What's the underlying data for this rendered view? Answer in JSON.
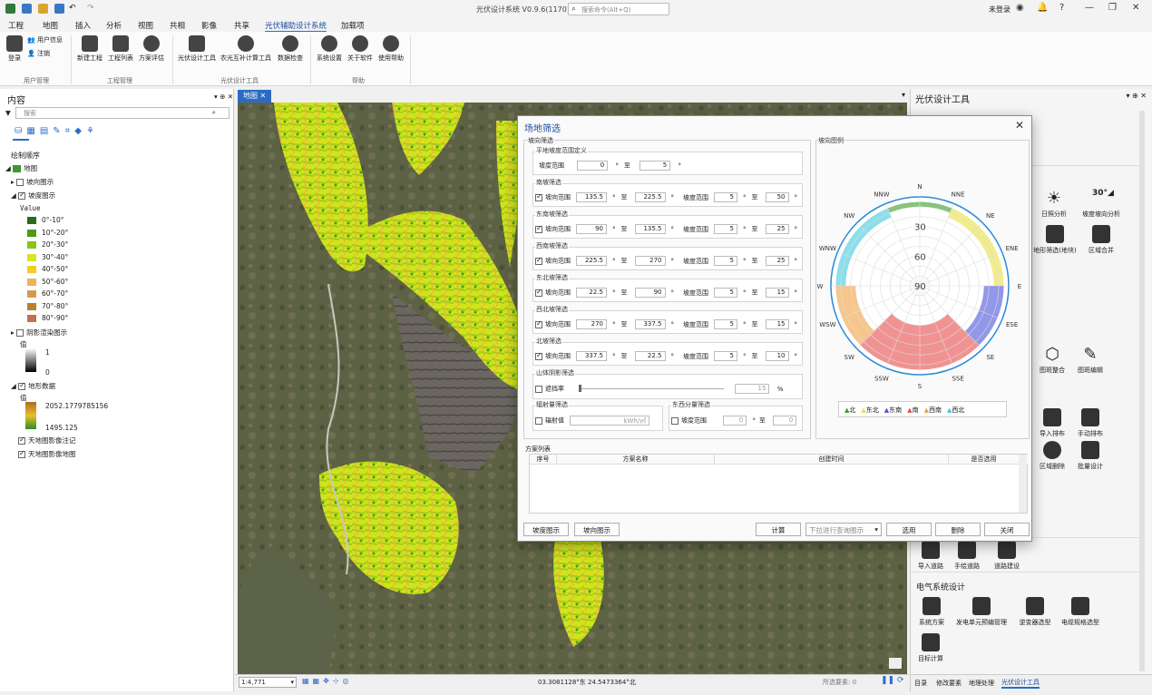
{
  "app": {
    "title": "光伏设计系统 V0.9.6(1170)",
    "search_placeholder": "搜索命令(Alt+Q)",
    "login": "未登录"
  },
  "ribbon": {
    "tabs": [
      "工程",
      "地图",
      "插入",
      "分析",
      "视图",
      "共相",
      "影像",
      "共享",
      "光伏辅助设计系统",
      "加载项"
    ],
    "active_tab": "光伏辅助设计系统",
    "user_group": {
      "label": "用户管理",
      "items": [
        "登录",
        "用户信息",
        "注销"
      ]
    },
    "project_group": {
      "label": "工程管理",
      "items": [
        "新建工程",
        "工程列表",
        "方案评估"
      ]
    },
    "pv_group": {
      "label": "光伏设计工具",
      "items": [
        "光伏设计工具",
        "农光互补计算工具",
        "数据检查"
      ]
    },
    "help_group": {
      "label": "帮助",
      "items": [
        "系统设置",
        "关于软件",
        "使用帮助"
      ]
    }
  },
  "contents": {
    "title": "内容",
    "search_placeholder": "搜索",
    "drawing_order": "绘制顺序",
    "map": "地图",
    "layers": [
      {
        "name": "坡向图示",
        "checked": false
      },
      {
        "name": "坡度图示",
        "checked": true
      }
    ],
    "value_label": "Value",
    "slope_legend": [
      {
        "label": "0°-10°",
        "color": "#2d6b18"
      },
      {
        "label": "10°-20°",
        "color": "#4e9a1a"
      },
      {
        "label": "20°-30°",
        "color": "#8dc21c"
      },
      {
        "label": "30°-40°",
        "color": "#d8e623"
      },
      {
        "label": "40°-50°",
        "color": "#f2cf1e"
      },
      {
        "label": "50°-60°",
        "color": "#eab45e"
      },
      {
        "label": "60°-70°",
        "color": "#d69a4f"
      },
      {
        "label": "70°-80°",
        "color": "#b7822d"
      },
      {
        "label": "80°-90°",
        "color": "#c46f56"
      }
    ],
    "hillshade": {
      "name": "阴影渲染图示",
      "checked": false,
      "value_label": "值",
      "max": "1",
      "min": "0"
    },
    "terrain": {
      "name": "地形数据",
      "checked": true,
      "value_label": "值",
      "max": "2052.1779785156",
      "min": "1495.125"
    },
    "tianditu_label": {
      "name": "天地图影像注记",
      "checked": true
    },
    "tianditu_image": {
      "name": "天地图影像地图",
      "checked": true
    }
  },
  "map": {
    "tab": "地图",
    "scale": "1:4,771",
    "coords": "03.3081128°东 24.5473364°北",
    "selected": "所选要素: 0"
  },
  "right_panel": {
    "title": "光伏设计工具",
    "tools_top": [
      "日照分析",
      "坡度坡向分析",
      "地形筛选(地块)",
      "区域合并"
    ],
    "tools_mid": [
      "图斑整合",
      "图斑编辑"
    ],
    "tools_row3": [
      "导入排布",
      "手动排布",
      "区域删除",
      "批量设计"
    ],
    "tools_row4": [
      "导入道路",
      "手绘道路",
      "道路建设"
    ],
    "electric_title": "电气系统设计",
    "electric_tools": [
      "系统方案",
      "发电单元预编管理",
      "逆变器选型",
      "电缆规格选型",
      "目标计算"
    ],
    "bottom_tabs": [
      "目录",
      "修改要素",
      "地理处理",
      "光伏设计工具"
    ]
  },
  "dialog": {
    "title": "场地筛选",
    "slope_section": "坡向筛选",
    "flat": {
      "title": "平地坡度范围定义",
      "label": "坡度范围",
      "from": "0",
      "to": "5"
    },
    "rows": [
      {
        "title": "南坡筛选",
        "checked": true,
        "aspect_from": "135.5",
        "aspect_to": "225.5",
        "slope_from": "5",
        "slope_to": "50"
      },
      {
        "title": "东南坡筛选",
        "checked": true,
        "aspect_from": "90",
        "aspect_to": "135.5",
        "slope_from": "5",
        "slope_to": "25"
      },
      {
        "title": "西南坡筛选",
        "checked": true,
        "aspect_from": "225.5",
        "aspect_to": "270",
        "slope_from": "5",
        "slope_to": "25"
      },
      {
        "title": "东北坡筛选",
        "checked": true,
        "aspect_from": "22.5",
        "aspect_to": "90",
        "slope_from": "5",
        "slope_to": "15"
      },
      {
        "title": "西北坡筛选",
        "checked": true,
        "aspect_from": "270",
        "aspect_to": "337.5",
        "slope_from": "5",
        "slope_to": "15"
      },
      {
        "title": "北坡筛选",
        "checked": true,
        "aspect_from": "337.5",
        "aspect_to": "22.5",
        "slope_from": "5",
        "slope_to": "10"
      }
    ],
    "aspect_label": "坡向范围",
    "slope_label": "坡度范围",
    "to": "至",
    "deg": "°",
    "hill": {
      "title": "山体阴影筛选",
      "label": "遮挡率",
      "value": "15",
      "unit": "%"
    },
    "radiation": {
      "title": "辐射量筛选",
      "label": "辐射值",
      "unit": "kWh/㎡"
    },
    "ew": {
      "title": "东西分量筛选",
      "label": "坡度范围",
      "from": "0",
      "to": "0"
    },
    "legend_title": "坡向图例",
    "compass": [
      "N",
      "NNE",
      "NE",
      "ENE",
      "E",
      "ESE",
      "SE",
      "SSE",
      "S",
      "SSW",
      "SW",
      "WSW",
      "W",
      "WNW",
      "NW",
      "NNW"
    ],
    "rings": [
      "30",
      "60",
      "90"
    ],
    "legend": [
      {
        "label": "北",
        "color": "#3a9a2a"
      },
      {
        "label": "东北",
        "color": "#e8e040"
      },
      {
        "label": "东南",
        "color": "#4a52d8"
      },
      {
        "label": "南",
        "color": "#e84a4a"
      },
      {
        "label": "西南",
        "color": "#f0a040"
      },
      {
        "label": "西北",
        "color": "#40c8e0"
      }
    ],
    "scheme_title": "方案列表",
    "table_headers": [
      "序号",
      "方案名称",
      "创建时间",
      "是否选用"
    ],
    "buttons": {
      "slope_display": "坡度图示",
      "aspect_display": "坡向图示",
      "calc": "计算",
      "select_placeholder": "下拉进行查询图示",
      "select": "选用",
      "delete": "删除",
      "close": "关闭"
    }
  }
}
